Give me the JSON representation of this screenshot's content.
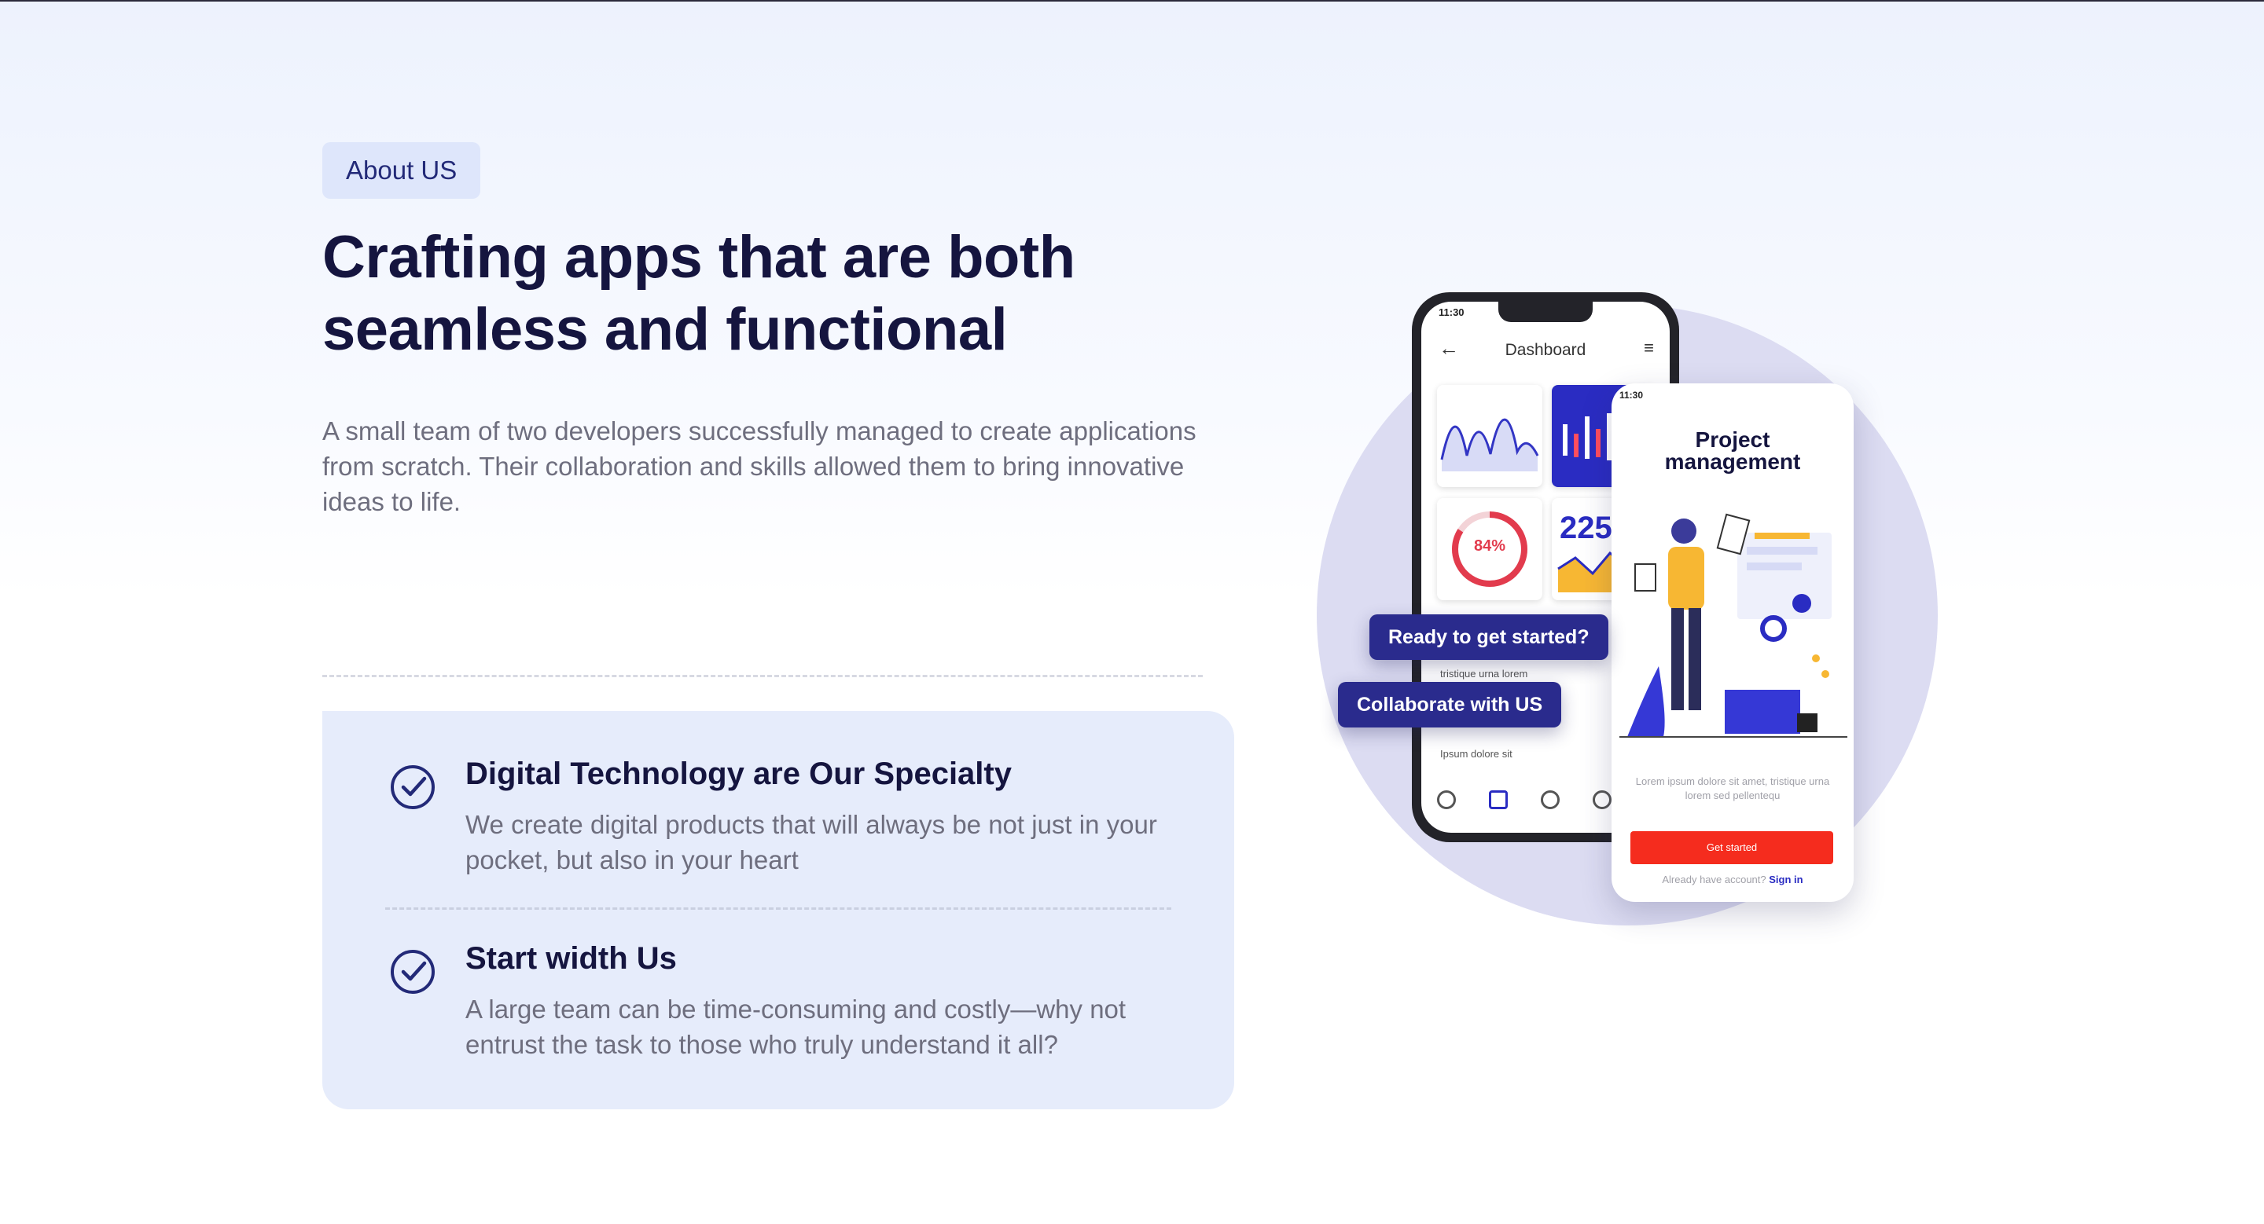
{
  "about": {
    "badge": "About US",
    "headline_line1": "Crafting apps that are both",
    "headline_line2": "seamless and functional",
    "intro": "A small team of two developers successfully managed to create applications from scratch. Their collaboration and skills allowed them to bring innovative ideas to life."
  },
  "features": [
    {
      "title": "Digital Technology are Our Specialty",
      "text": "We create digital products that will always be not just in your pocket, but also in your heart",
      "icon": "check-circle-icon"
    },
    {
      "title": "Start width Us",
      "text": "A large team can be time-consuming and costly—why not entrust the task to those who truly understand it all?",
      "icon": "check-circle-icon"
    }
  ],
  "illustration": {
    "cta_primary": "Ready to get started?",
    "cta_secondary": "Collaborate with US",
    "dashboard_phone": {
      "time": "11:30",
      "title": "Dashboard",
      "ring_value": "84%",
      "stat_value": "225",
      "list_item_1": "tristique urna lorem",
      "list_item_2": "Ipsum dolore sit"
    },
    "project_phone": {
      "time": "11:30",
      "title_line1": "Project",
      "title_line2": "management",
      "body": "Lorem ipsum dolore sit amet, tristique urna lorem sed pellentequ",
      "button": "Get started",
      "account_prompt": "Already have account?",
      "signin_link": "Sign in"
    }
  },
  "colors": {
    "accent_dark": "#2a2b8d",
    "heading": "#15153f",
    "body_text": "#6e6e7e",
    "feature_bg": "#e6ecfb",
    "badge_bg": "#dee6fb",
    "cta_red": "#f52c1e"
  }
}
